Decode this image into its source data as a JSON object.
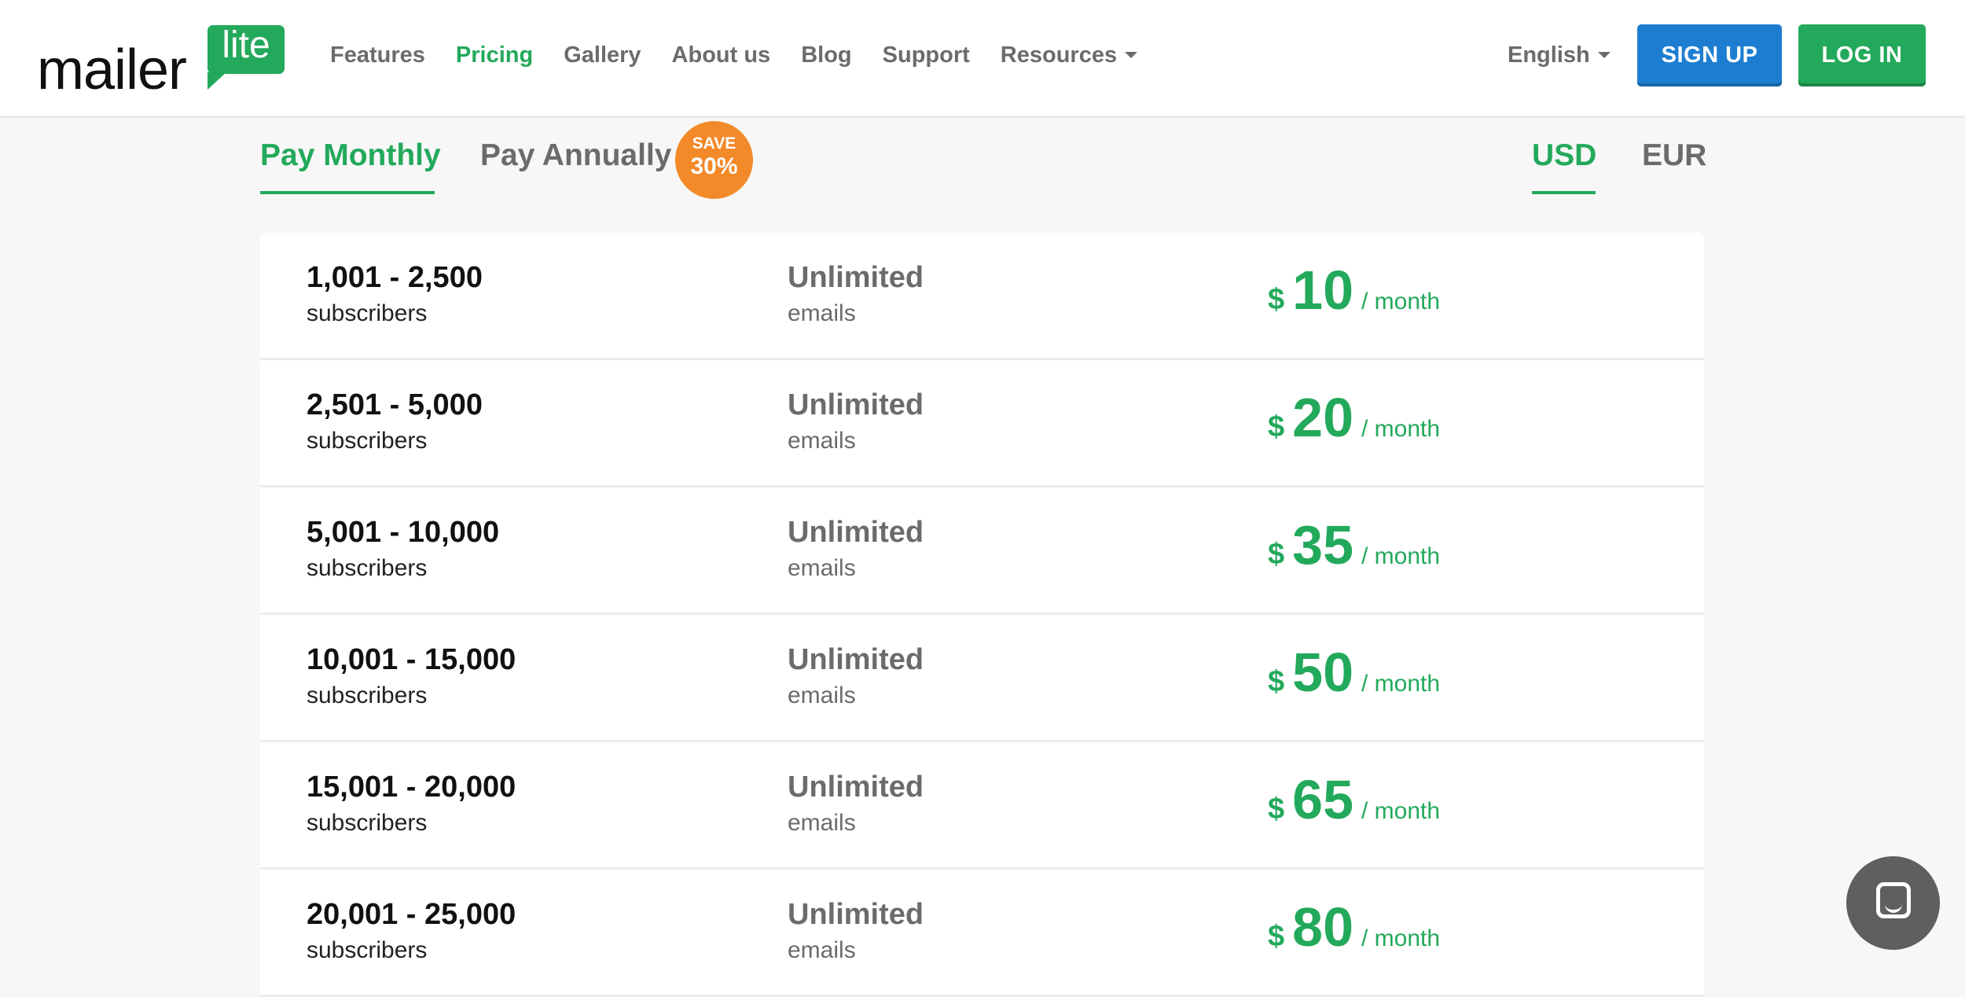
{
  "logo": {
    "text_main": "mailer",
    "text_bubble": "lite"
  },
  "nav": {
    "items": [
      {
        "label": "Features",
        "active": false
      },
      {
        "label": "Pricing",
        "active": true
      },
      {
        "label": "Gallery",
        "active": false
      },
      {
        "label": "About us",
        "active": false
      },
      {
        "label": "Blog",
        "active": false
      },
      {
        "label": "Support",
        "active": false
      },
      {
        "label": "Resources",
        "active": false,
        "dropdown": true
      }
    ]
  },
  "language": {
    "label": "English"
  },
  "buttons": {
    "signup": "SIGN UP",
    "login": "LOG IN"
  },
  "billing": {
    "monthly": "Pay Monthly",
    "annually": "Pay Annually",
    "save_line1": "SAVE",
    "save_line2": "30%",
    "selected": "monthly"
  },
  "currency": {
    "usd": "USD",
    "eur": "EUR",
    "selected": "USD"
  },
  "plans": [
    {
      "range": "1,001 - 2,500",
      "sub": "subscribers",
      "emails": "Unlimited",
      "emails_sub": "emails",
      "currency_symbol": "$",
      "price": "10",
      "period": "/ month"
    },
    {
      "range": "2,501 - 5,000",
      "sub": "subscribers",
      "emails": "Unlimited",
      "emails_sub": "emails",
      "currency_symbol": "$",
      "price": "20",
      "period": "/ month"
    },
    {
      "range": "5,001 - 10,000",
      "sub": "subscribers",
      "emails": "Unlimited",
      "emails_sub": "emails",
      "currency_symbol": "$",
      "price": "35",
      "period": "/ month"
    },
    {
      "range": "10,001 - 15,000",
      "sub": "subscribers",
      "emails": "Unlimited",
      "emails_sub": "emails",
      "currency_symbol": "$",
      "price": "50",
      "period": "/ month"
    },
    {
      "range": "15,001 - 20,000",
      "sub": "subscribers",
      "emails": "Unlimited",
      "emails_sub": "emails",
      "currency_symbol": "$",
      "price": "65",
      "period": "/ month"
    },
    {
      "range": "20,001 - 25,000",
      "sub": "subscribers",
      "emails": "Unlimited",
      "emails_sub": "emails",
      "currency_symbol": "$",
      "price": "80",
      "period": "/ month"
    }
  ],
  "colors": {
    "brand_green": "#23a95b",
    "signup_blue": "#1d7ed1",
    "save_orange": "#f28a2a",
    "text_gray": "#6b6b6b"
  },
  "chat": {
    "icon": "chat-icon"
  }
}
